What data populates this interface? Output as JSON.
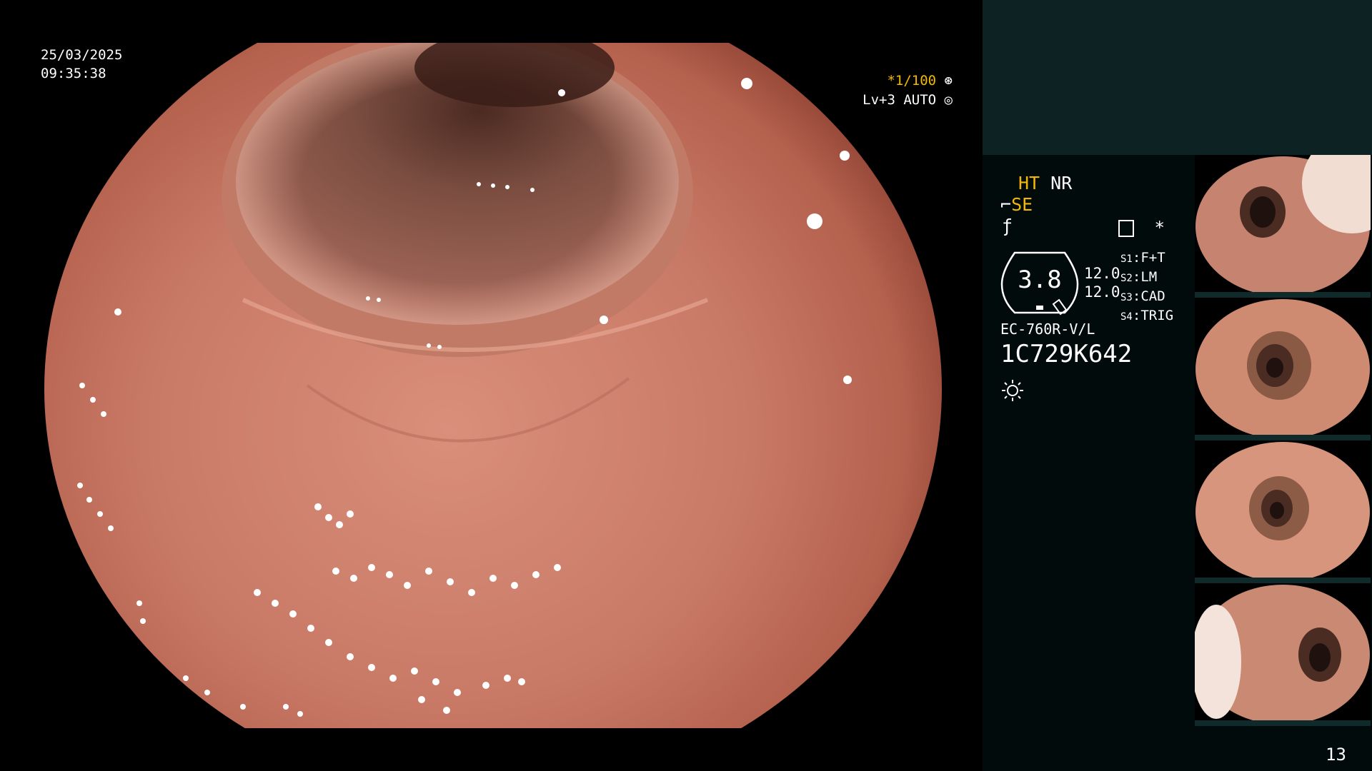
{
  "overlay": {
    "date": "25/03/2025",
    "time": "09:35:38",
    "shutter": "*1/100",
    "light_level": "Lv+3 AUTO",
    "shutter_icon": "aperture-icon",
    "auto_icon": "target-icon"
  },
  "panel": {
    "ht": "HT",
    "nr": "NR",
    "se": "SE",
    "se_icon": "scope-icon",
    "f_icon": "freeze-icon",
    "menu_icon": "settings-box-icon",
    "star": "*",
    "gauge_value": "3.8",
    "left_values": [
      "12.0",
      "12.0"
    ],
    "slots": [
      {
        "key": "S1",
        "value": "F+T"
      },
      {
        "key": "S2",
        "value": "LM"
      },
      {
        "key": "S3",
        "value": "CAD"
      },
      {
        "key": "S4",
        "value": "TRIG"
      }
    ],
    "scope_model": "EC-760R-V/L",
    "scope_serial": "1C729K642",
    "light_icon": "sun-icon"
  },
  "page_number": "13",
  "colors": {
    "panel_bg": "#020b0b",
    "panel_top_bg": "#0d2222",
    "highlight": "#f5b800",
    "mucosa": "#c97a66"
  }
}
